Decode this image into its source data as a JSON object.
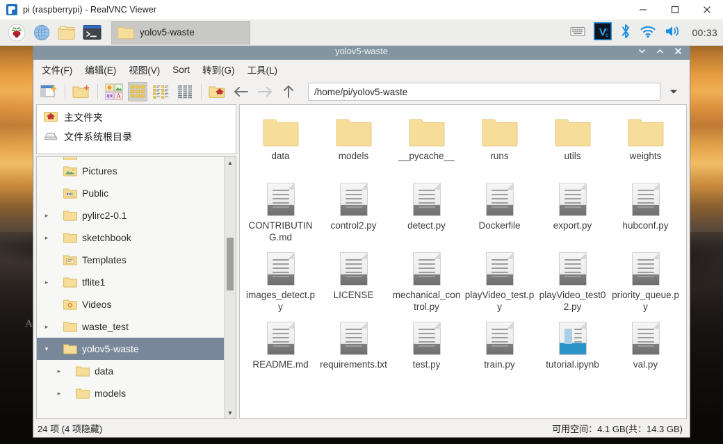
{
  "vnc": {
    "title": "pi (raspberrypi) - RealVNC Viewer",
    "app_icon": "realvnc-icon",
    "controls": {
      "minimize": "minimize-icon",
      "maximize": "maximize-icon",
      "close": "close-icon"
    }
  },
  "taskbar": {
    "launchers": [
      {
        "name": "raspberry-menu-icon",
        "label": "Raspberry Pi Menu"
      },
      {
        "name": "web-browser-icon",
        "label": "Web Browser"
      },
      {
        "name": "file-manager-icon",
        "label": "File Manager"
      },
      {
        "name": "terminal-icon",
        "label": "Terminal"
      }
    ],
    "task_button": {
      "label": "yolov5-waste",
      "icon": "folder-icon"
    },
    "tray": [
      {
        "name": "keyboard-icon",
        "label": "Keyboard Layout"
      },
      {
        "name": "vnc-server-icon",
        "label": "VNC Server"
      },
      {
        "name": "bluetooth-icon",
        "label": "Bluetooth"
      },
      {
        "name": "wifi-icon",
        "label": "Wireless Network"
      },
      {
        "name": "volume-icon",
        "label": "Volume"
      }
    ],
    "clock": "00:33"
  },
  "file_manager": {
    "title": "yolov5-waste",
    "window_controls": {
      "minimize": "chevron-down-icon",
      "maximize": "chevron-up-icon",
      "close": "close-icon"
    },
    "menus": [
      {
        "label": "文件(F)",
        "accel": "F"
      },
      {
        "label": "编辑(E)",
        "accel": "E"
      },
      {
        "label": "视图(V)",
        "accel": "V"
      },
      {
        "label": "Sort",
        "accel": "o"
      },
      {
        "label": "转到(G)",
        "accel": "G"
      },
      {
        "label": "工具(L)",
        "accel": "L"
      }
    ],
    "toolbar": [
      {
        "name": "new-window-button",
        "tip": "New Window"
      },
      {
        "name": "new-folder-button",
        "tip": "New Folder"
      },
      {
        "name": "filter-file-type-button",
        "tip": "Show file types"
      },
      {
        "name": "icon-view-button",
        "tip": "Icon View",
        "active": true
      },
      {
        "name": "compact-view-button",
        "tip": "Compact View",
        "active": false
      },
      {
        "name": "detailed-list-view-button",
        "tip": "Detailed List View",
        "active": false
      },
      {
        "name": "home-button",
        "tip": "Home"
      },
      {
        "name": "back-button",
        "tip": "Back"
      },
      {
        "name": "forward-button",
        "tip": "Forward"
      },
      {
        "name": "up-button",
        "tip": "Up one level"
      }
    ],
    "path": {
      "value": "/home/pi/yolov5-waste",
      "placeholder": "/home/pi/yolov5-waste",
      "dropdown": "chevron-down-icon"
    },
    "places": [
      {
        "label": "主文件夹",
        "icon": "home-folder-icon"
      },
      {
        "label": "文件系统根目录",
        "icon": "drive-icon"
      }
    ],
    "tree": [
      {
        "label": "Pictures",
        "icon": "pictures-folder-icon",
        "indent": 2,
        "twisty": "",
        "selected": false
      },
      {
        "label": "Public",
        "icon": "public-folder-icon",
        "indent": 2,
        "twisty": "",
        "selected": false
      },
      {
        "label": "pylirc2-0.1",
        "icon": "folder-icon",
        "indent": 2,
        "twisty": "▸",
        "selected": false
      },
      {
        "label": "sketchbook",
        "icon": "folder-icon",
        "indent": 2,
        "twisty": "▸",
        "selected": false
      },
      {
        "label": "Templates",
        "icon": "templates-folder-icon",
        "indent": 2,
        "twisty": "",
        "selected": false
      },
      {
        "label": "tflite1",
        "icon": "folder-icon",
        "indent": 2,
        "twisty": "▸",
        "selected": false
      },
      {
        "label": "Videos",
        "icon": "videos-folder-icon",
        "indent": 2,
        "twisty": "",
        "selected": false
      },
      {
        "label": "waste_test",
        "icon": "folder-icon",
        "indent": 2,
        "twisty": "▸",
        "selected": false
      },
      {
        "label": "yolov5-waste",
        "icon": "folder-icon",
        "indent": 2,
        "twisty": "▾",
        "selected": true
      },
      {
        "label": "data",
        "icon": "folder-icon",
        "indent": 3,
        "twisty": "▸",
        "selected": false
      },
      {
        "label": "models",
        "icon": "folder-icon",
        "indent": 3,
        "twisty": "▸",
        "selected": false
      }
    ],
    "items": [
      {
        "name": "data",
        "type": "folder"
      },
      {
        "name": "models",
        "type": "folder"
      },
      {
        "name": "__pycache__",
        "type": "folder"
      },
      {
        "name": "runs",
        "type": "folder"
      },
      {
        "name": "utils",
        "type": "folder"
      },
      {
        "name": "weights",
        "type": "folder"
      },
      {
        "name": "CONTRIBUTING.md",
        "type": "document"
      },
      {
        "name": "control2.py",
        "type": "document"
      },
      {
        "name": "detect.py",
        "type": "document"
      },
      {
        "name": "Dockerfile",
        "type": "document"
      },
      {
        "name": "export.py",
        "type": "document"
      },
      {
        "name": "hubconf.py",
        "type": "document"
      },
      {
        "name": "images_detect.py",
        "type": "document"
      },
      {
        "name": "LICENSE",
        "type": "document"
      },
      {
        "name": "mechanical_control.py",
        "type": "document"
      },
      {
        "name": "playVideo_test.py",
        "type": "document"
      },
      {
        "name": "playVideo_test02.py",
        "type": "document"
      },
      {
        "name": "priority_queue.py",
        "type": "document"
      },
      {
        "name": "README.md",
        "type": "document"
      },
      {
        "name": "requirements.txt",
        "type": "document"
      },
      {
        "name": "test.py",
        "type": "document"
      },
      {
        "name": "train.py",
        "type": "document"
      },
      {
        "name": "tutorial.ipynb",
        "type": "notebook"
      },
      {
        "name": "val.py",
        "type": "document"
      }
    ],
    "status": {
      "left": "24 项 (4 项隐藏)",
      "right": "可用空间：4.1 GB(共：14.3 GB)"
    }
  },
  "colors": {
    "titlebar": "#8395a0",
    "selection": "#78889a",
    "taskbar": "#ededeb",
    "window_bg": "#f2f1f0",
    "folder": "#f7dd9a",
    "accent_blue": "#2b93c6"
  }
}
